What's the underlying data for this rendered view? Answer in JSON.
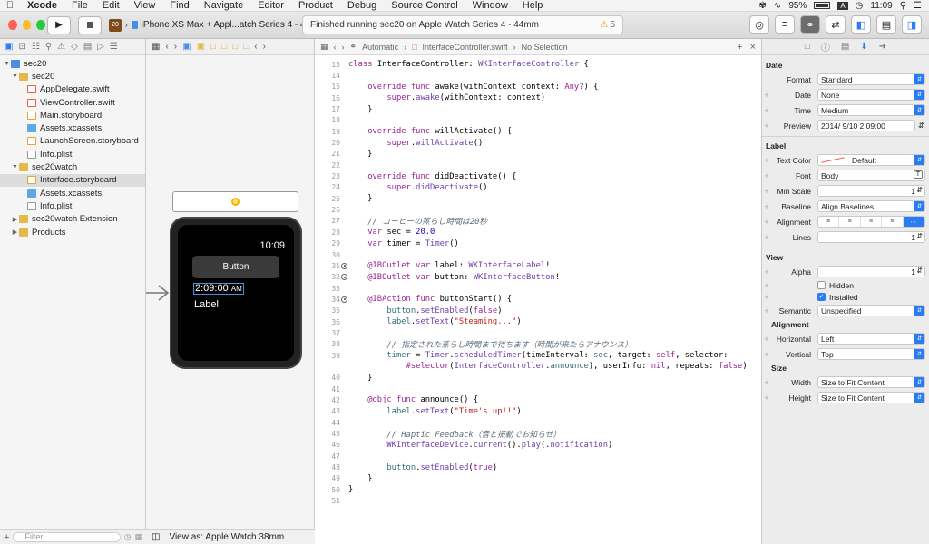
{
  "menubar": {
    "app": "Xcode",
    "items": [
      "File",
      "Edit",
      "View",
      "Find",
      "Navigate",
      "Editor",
      "Product",
      "Debug",
      "Source Control",
      "Window",
      "Help"
    ],
    "battery": "95%",
    "battery_level": 0.95,
    "input_method": "A",
    "clock": "11:09"
  },
  "toolbar": {
    "scheme_badge": "20",
    "scheme": "iPhone XS Max + Appl...atch Series 4 - 44mm",
    "status": "Finished running sec20 on Apple Watch Series 4 - 44mm",
    "warnings": "5"
  },
  "navigator": {
    "filter_placeholder": "Filter",
    "items": [
      {
        "label": "sec20",
        "icon": "project",
        "level": 0,
        "disclosure": "▼"
      },
      {
        "label": "sec20",
        "icon": "folder",
        "level": 1,
        "disclosure": "▼"
      },
      {
        "label": "AppDelegate.swift",
        "icon": "swift",
        "level": 2,
        "disclosure": ""
      },
      {
        "label": "ViewController.swift",
        "icon": "swift",
        "level": 2,
        "disclosure": ""
      },
      {
        "label": "Main.storyboard",
        "icon": "storyboard",
        "level": 2,
        "disclosure": ""
      },
      {
        "label": "Assets.xcassets",
        "icon": "assets",
        "level": 2,
        "disclosure": ""
      },
      {
        "label": "LaunchScreen.storyboard",
        "icon": "storyboard",
        "level": 2,
        "disclosure": ""
      },
      {
        "label": "Info.plist",
        "icon": "plist",
        "level": 2,
        "disclosure": ""
      },
      {
        "label": "sec20watch",
        "icon": "folder",
        "level": 1,
        "disclosure": "▼"
      },
      {
        "label": "Interface.storyboard",
        "icon": "storyboard",
        "level": 2,
        "disclosure": "",
        "selected": true
      },
      {
        "label": "Assets.xcassets",
        "icon": "assets",
        "level": 2,
        "disclosure": ""
      },
      {
        "label": "Info.plist",
        "icon": "plist",
        "level": 2,
        "disclosure": ""
      },
      {
        "label": "sec20watch Extension",
        "icon": "folder",
        "level": 1,
        "disclosure": "▶"
      },
      {
        "label": "Products",
        "icon": "folder",
        "level": 1,
        "disclosure": "▶"
      }
    ]
  },
  "canvas": {
    "watch_time": "10:09",
    "button_label": "Button",
    "date_label": "2:09:00",
    "date_ampm": "AM",
    "label_text": "Label",
    "view_as": "View as: Apple Watch 38mm"
  },
  "editor": {
    "jump_mode": "Automatic",
    "jump_file": "InterfaceController.swift",
    "jump_selection": "No Selection",
    "lines": [
      {
        "n": "13",
        "outlet": false,
        "html": "<span class=\"kw\">class</span> InterfaceController: <span class=\"ty\">WKInterfaceController</span> {"
      },
      {
        "n": "14",
        "outlet": false,
        "html": ""
      },
      {
        "n": "15",
        "outlet": false,
        "html": "    <span class=\"kw\">override func</span> awake(withContext context: <span class=\"kw\">Any</span>?) {"
      },
      {
        "n": "16",
        "outlet": false,
        "html": "        <span class=\"kw\">super</span>.<span class=\"ty\">awake</span>(withContext: context)"
      },
      {
        "n": "17",
        "outlet": false,
        "html": "    }"
      },
      {
        "n": "18",
        "outlet": false,
        "html": ""
      },
      {
        "n": "19",
        "outlet": false,
        "html": "    <span class=\"kw\">override func</span> willActivate() {"
      },
      {
        "n": "20",
        "outlet": false,
        "html": "        <span class=\"kw\">super</span>.<span class=\"ty\">willActivate</span>()"
      },
      {
        "n": "21",
        "outlet": false,
        "html": "    }"
      },
      {
        "n": "22",
        "outlet": false,
        "html": ""
      },
      {
        "n": "23",
        "outlet": false,
        "html": "    <span class=\"kw\">override func</span> didDeactivate() {"
      },
      {
        "n": "24",
        "outlet": false,
        "html": "        <span class=\"kw\">super</span>.<span class=\"ty\">didDeactivate</span>()"
      },
      {
        "n": "25",
        "outlet": false,
        "html": "    }"
      },
      {
        "n": "26",
        "outlet": false,
        "html": ""
      },
      {
        "n": "27",
        "outlet": false,
        "html": "    <span class=\"cm\">// コーヒーの蒸らし時間は20秒</span>"
      },
      {
        "n": "28",
        "outlet": false,
        "html": "    <span class=\"kw\">var</span> sec = <span class=\"num\">20.0</span>"
      },
      {
        "n": "29",
        "outlet": false,
        "html": "    <span class=\"kw\">var</span> timer = <span class=\"ty\">Timer</span>()"
      },
      {
        "n": "30",
        "outlet": false,
        "html": ""
      },
      {
        "n": "31",
        "outlet": true,
        "html": "    <span class=\"kw\">@IBOutlet var</span> label: <span class=\"ty\">WKInterfaceLabel</span>!"
      },
      {
        "n": "32",
        "outlet": true,
        "html": "    <span class=\"kw\">@IBOutlet var</span> button: <span class=\"ty\">WKInterfaceButton</span>!"
      },
      {
        "n": "33",
        "outlet": false,
        "html": ""
      },
      {
        "n": "34",
        "outlet": true,
        "html": "    <span class=\"kw\">@IBAction func</span> buttonStart() {"
      },
      {
        "n": "35",
        "outlet": false,
        "html": "        <span class=\"fn\">button</span>.<span class=\"ty\">setEnabled</span>(<span class=\"kw\">false</span>)"
      },
      {
        "n": "36",
        "outlet": false,
        "html": "        <span class=\"fn\">label</span>.<span class=\"ty\">setText</span>(<span class=\"str\">\"Steaming...\"</span>)"
      },
      {
        "n": "37",
        "outlet": false,
        "html": ""
      },
      {
        "n": "38",
        "outlet": false,
        "html": "        <span class=\"cm\">// 指定された蒸らし時間まで待ちます（時間が来たらアナウンス）</span>"
      },
      {
        "n": "39",
        "outlet": false,
        "html": "        <span class=\"fn\">timer</span> = <span class=\"ty\">Timer</span>.<span class=\"ty\">scheduledTimer</span>(timeInterval: <span class=\"fn\">sec</span>, target: <span class=\"kw\">self</span>, selector:"
      },
      {
        "n": "",
        "outlet": false,
        "html": "            <span class=\"kw\">#selector</span>(<span class=\"ty\">InterfaceController</span>.<span class=\"fn\">announce</span>), userInfo: <span class=\"kw\">nil</span>, repeats: <span class=\"kw\">false</span>)"
      },
      {
        "n": "40",
        "outlet": false,
        "html": "    }"
      },
      {
        "n": "41",
        "outlet": false,
        "html": ""
      },
      {
        "n": "42",
        "outlet": false,
        "html": "    <span class=\"kw\">@objc func</span> announce() {"
      },
      {
        "n": "43",
        "outlet": false,
        "html": "        <span class=\"fn\">label</span>.<span class=\"ty\">setText</span>(<span class=\"str\">\"Time's up!!\"</span>)"
      },
      {
        "n": "44",
        "outlet": false,
        "html": ""
      },
      {
        "n": "45",
        "outlet": false,
        "html": "        <span class=\"cm\">// Haptic Feedback（音と振動でお知らせ）</span>"
      },
      {
        "n": "46",
        "outlet": false,
        "html": "        <span class=\"ty\">WKInterfaceDevice</span>.<span class=\"ty\">current</span>().<span class=\"ty\">play</span>(.<span class=\"ty\">notification</span>)"
      },
      {
        "n": "47",
        "outlet": false,
        "html": ""
      },
      {
        "n": "48",
        "outlet": false,
        "html": "        <span class=\"fn\">button</span>.<span class=\"ty\">setEnabled</span>(<span class=\"kw\">true</span>)"
      },
      {
        "n": "49",
        "outlet": false,
        "html": "    }"
      },
      {
        "n": "50",
        "outlet": false,
        "html": "}"
      },
      {
        "n": "51",
        "outlet": false,
        "html": ""
      }
    ]
  },
  "inspector": {
    "date": {
      "title": "Date",
      "format_label": "Format",
      "format": "Standard",
      "date_label": "Date",
      "date": "None",
      "time_label": "Time",
      "time": "Medium",
      "preview_label": "Preview",
      "preview": "2014/ 9/10   2:09:00"
    },
    "label": {
      "title": "Label",
      "text_color_label": "Text Color",
      "text_color": "Default",
      "font_label": "Font",
      "font": "Body",
      "min_scale_label": "Min Scale",
      "min_scale": "1",
      "baseline_label": "Baseline",
      "baseline": "Align Baselines",
      "alignment_label": "Alignment",
      "lines_label": "Lines",
      "lines": "1"
    },
    "view": {
      "title": "View",
      "alpha_label": "Alpha",
      "alpha": "1",
      "hidden_label": "Hidden",
      "installed_label": "Installed",
      "semantic_label": "Semantic",
      "semantic": "Unspecified",
      "alignment_title": "Alignment",
      "horizontal_label": "Horizontal",
      "horizontal": "Left",
      "vertical_label": "Vertical",
      "vertical": "Top",
      "size_title": "Size",
      "width_label": "Width",
      "width": "Size to Fit Content",
      "height_label": "Height",
      "height": "Size to Fit Content"
    }
  },
  "colors": {
    "accent": "#2b7cf3",
    "close": "#fc5f57",
    "minimize": "#fdbc2e",
    "zoom": "#28c840"
  }
}
